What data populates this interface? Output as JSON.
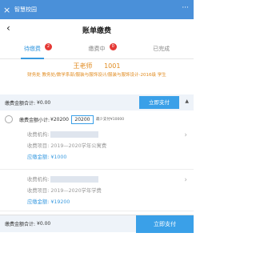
{
  "app": {
    "title": "智慧校园",
    "close_glyph": "×",
    "more_glyph": "···"
  },
  "nav": {
    "back_glyph": "‹",
    "title": "账单缴费"
  },
  "tabs": [
    {
      "label": "待缴费",
      "badge": "2"
    },
    {
      "label": "缴费中",
      "badge": "0"
    },
    {
      "label": "已完成"
    }
  ],
  "student": {
    "name": "王老师",
    "id": "1001",
    "dept": "财务处 教务处/数学系部/服装与服饰设计/服装与服饰设计-2016级 学生"
  },
  "summary": {
    "label": "缴费金额合计:",
    "amount": "¥0.00",
    "pay_button": "立即支付",
    "collapse_glyph": "▲"
  },
  "subtotal": {
    "label": "缴费金额小计:",
    "amount": "¥20200",
    "input_value": "20200",
    "hint": "最少支付¥10000"
  },
  "items": [
    {
      "org_label": "收费机构:",
      "project_label": "收费项目:",
      "project_value": "2019—2020学年公寓费",
      "due_label": "应缴金额:",
      "due_value": "¥1000"
    },
    {
      "org_label": "收费机构:",
      "project_label": "收费项目:",
      "project_value": "2019—2020学年学费",
      "due_label": "应缴金额:",
      "due_value": "¥19200"
    }
  ],
  "footer": {
    "label": "缴费金额合计:",
    "amount": "¥0.00",
    "pay_button": "立即支付"
  },
  "colors": {
    "primary": "#3aa0e8",
    "accent_orange": "#e08a1e",
    "badge_red": "#e53935"
  }
}
